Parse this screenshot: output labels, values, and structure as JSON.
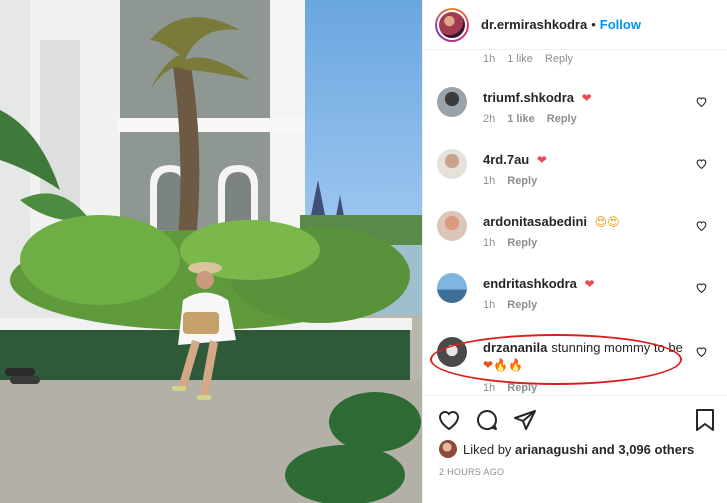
{
  "post": {
    "username": "dr.ermirashkodra",
    "dot": "•",
    "follow_label": "Follow",
    "photo_description_icon": "photo",
    "liked_by_prefix": "Liked by",
    "liked_by_user": "arianagushi",
    "liked_by_suffix": "and 3,096 others",
    "timestamp": "2 HOURS AGO"
  },
  "cut_comment": {
    "time": "1h",
    "likes": "1 like",
    "reply": "Reply"
  },
  "comments": [
    {
      "user": "triumf.shkodra",
      "text": "",
      "emoji": "❤",
      "time": "2h",
      "likes": "1 like",
      "reply": "Reply"
    },
    {
      "user": "4rd.7au",
      "text": "",
      "emoji": "❤",
      "time": "1h",
      "likes": "",
      "reply": "Reply"
    },
    {
      "user": "ardonitasabedini",
      "text": "",
      "emoji": "😍😍",
      "time": "1h",
      "likes": "",
      "reply": "Reply"
    },
    {
      "user": "endritashkodra",
      "text": "",
      "emoji": "❤",
      "time": "1h",
      "likes": "",
      "reply": "Reply"
    },
    {
      "user": "drzananila",
      "text": "stunning mommy to be",
      "emoji": "❤🔥🔥",
      "time": "1h",
      "likes": "",
      "reply": "Reply"
    }
  ],
  "colors": {
    "follow": "#0095f6",
    "highlight": "#d9201e",
    "heart": "#ed4956"
  }
}
